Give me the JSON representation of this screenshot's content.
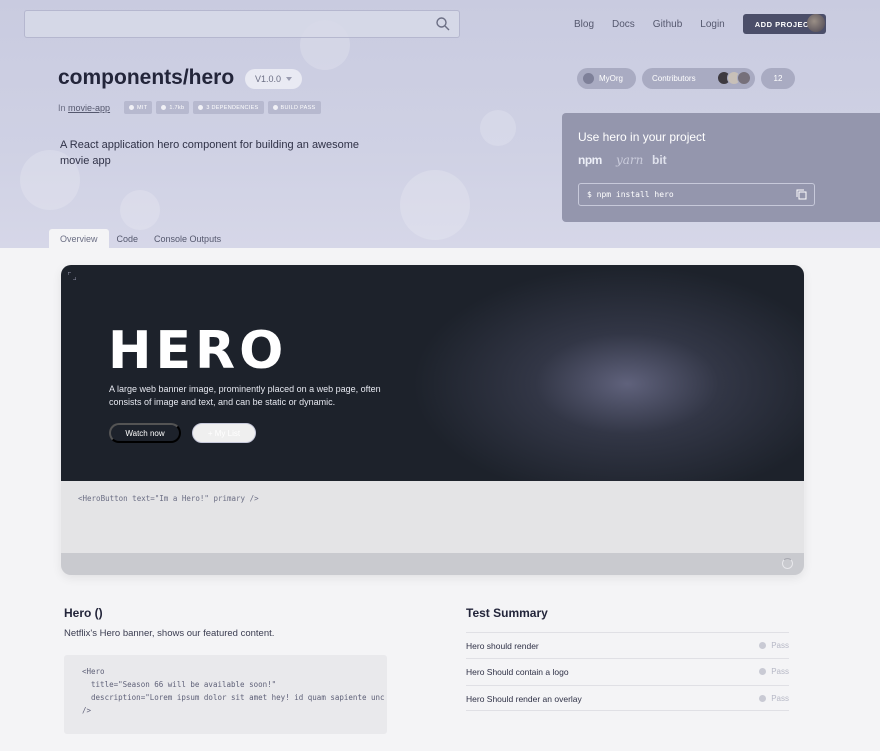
{
  "search": {
    "placeholder": ""
  },
  "nav": {
    "blog": "Blog",
    "docs": "Docs",
    "github": "Github",
    "login": "Login",
    "add_project": "ADD PROJECT"
  },
  "component": {
    "title": "components/hero",
    "version": "V1.0.0",
    "in_label": "In",
    "app_name": "movie-app",
    "badges": [
      "MIT",
      "1.7kb",
      "3 DEPENDENCIES",
      "BUILD PASS"
    ],
    "description": "A React application hero component for building an awesome movie app"
  },
  "org": {
    "name": "MyOrg"
  },
  "contributors": {
    "label": "Contributors",
    "count": "12"
  },
  "use_panel": {
    "heading": "Use hero in your project",
    "managers": [
      "npm",
      "yarn",
      "bit"
    ],
    "install_command": "$ npm install hero"
  },
  "tabs": [
    "Overview",
    "Code",
    "Console Outputs"
  ],
  "preview": {
    "logo_text": "HERO",
    "text": "A large web banner image, prominently placed on a web page, often consists of image and text, and can be static or dynamic.",
    "watch_label": "Watch now",
    "list_label": "+ My List",
    "snippet": "<HeroButton text=\"Im a Hero!\" primary />"
  },
  "docs": {
    "title": "Hero ()",
    "subtitle": "Netflix's Hero banner, shows our featured content.",
    "code_lines": [
      "<Hero",
      "  title=\"Season 66 will be available soon!\"",
      "  description=\"Lorem ipsum dolor sit amet hey! id quam sapiente unc",
      "/>"
    ]
  },
  "tests": {
    "title": "Test Summary",
    "items": [
      {
        "name": "Hero should render",
        "status": "Pass"
      },
      {
        "name": "Hero Should contain a logo",
        "status": "Pass"
      },
      {
        "name": "Hero Should render an overlay",
        "status": "Pass"
      }
    ]
  },
  "colors": {
    "accent": "#4b4e69",
    "banner": "#1d222b",
    "panel": "#9496ad"
  }
}
